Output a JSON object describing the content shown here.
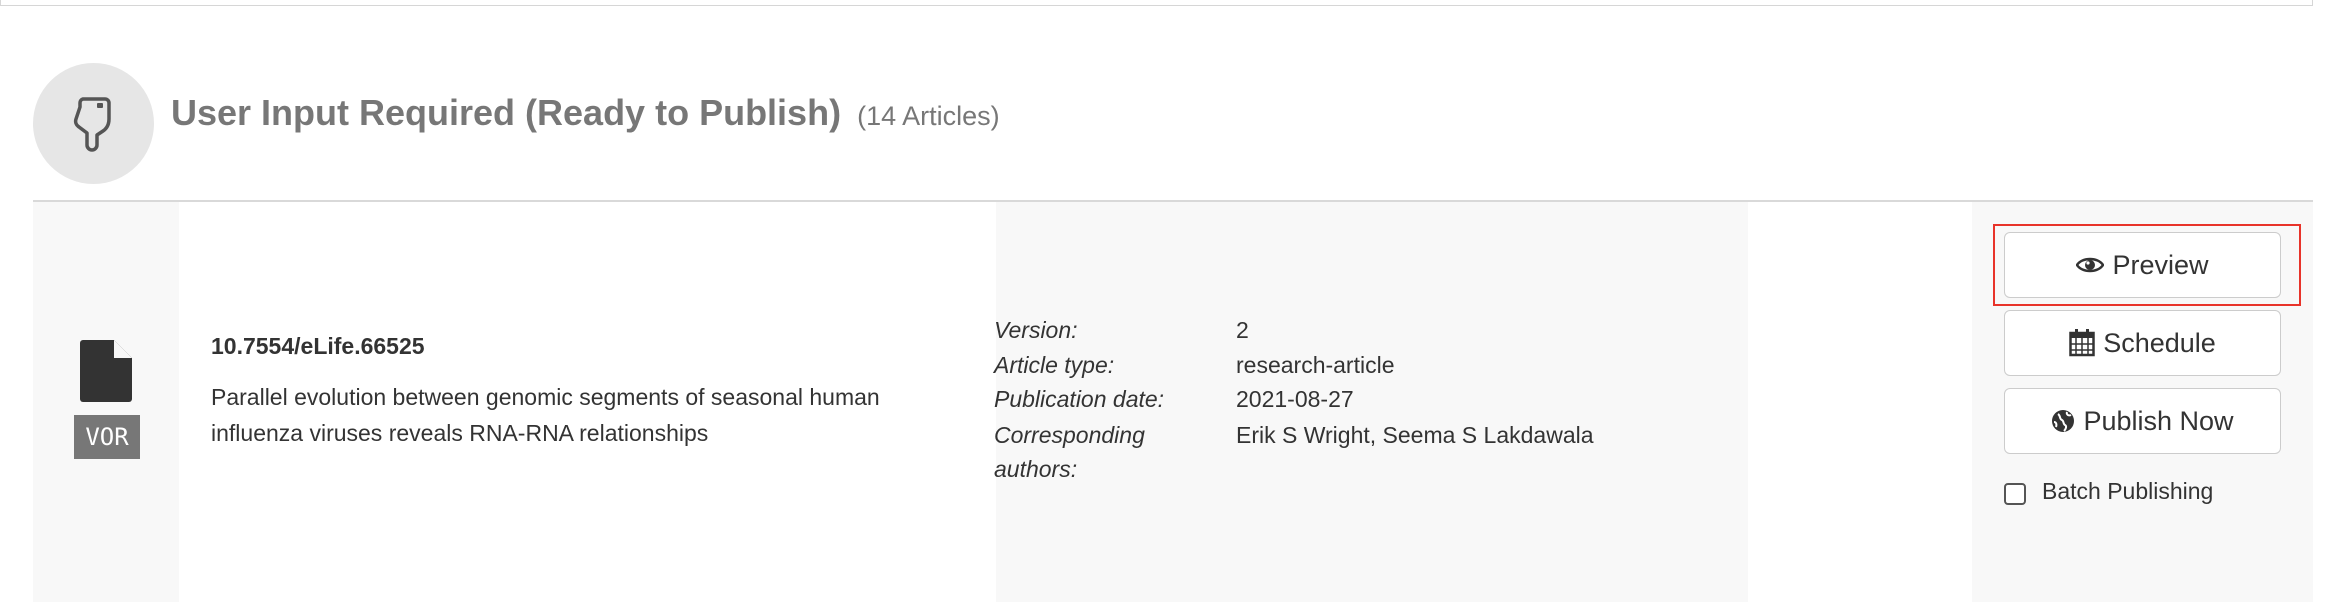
{
  "section": {
    "title": "User Input Required (Ready to Publish)",
    "count": "(14 Articles)",
    "icon": "pointing-hand-down-icon"
  },
  "article": {
    "doi": "10.7554/eLife.66525",
    "title": "Parallel evolution between genomic segments of seasonal human influenza viruses reveals RNA-RNA relationships",
    "badge": "VOR",
    "file_icon": "document-icon",
    "meta": [
      {
        "label": "Version:",
        "value": "2"
      },
      {
        "label": "Article type:",
        "value": "research-article"
      },
      {
        "label": "Publication date:",
        "value": "2021-08-27"
      },
      {
        "label": "Corresponding authors:",
        "value": "Erik S Wright, Seema S Lakdawala"
      }
    ]
  },
  "actions": {
    "preview": "Preview",
    "schedule": "Schedule",
    "publish_now": "Publish Now",
    "batch_publishing": "Batch Publishing",
    "batch_checked": false
  },
  "colors": {
    "highlight": "#e8332a",
    "badge_bg": "#777777",
    "row_bg": "#f8f8f8"
  }
}
